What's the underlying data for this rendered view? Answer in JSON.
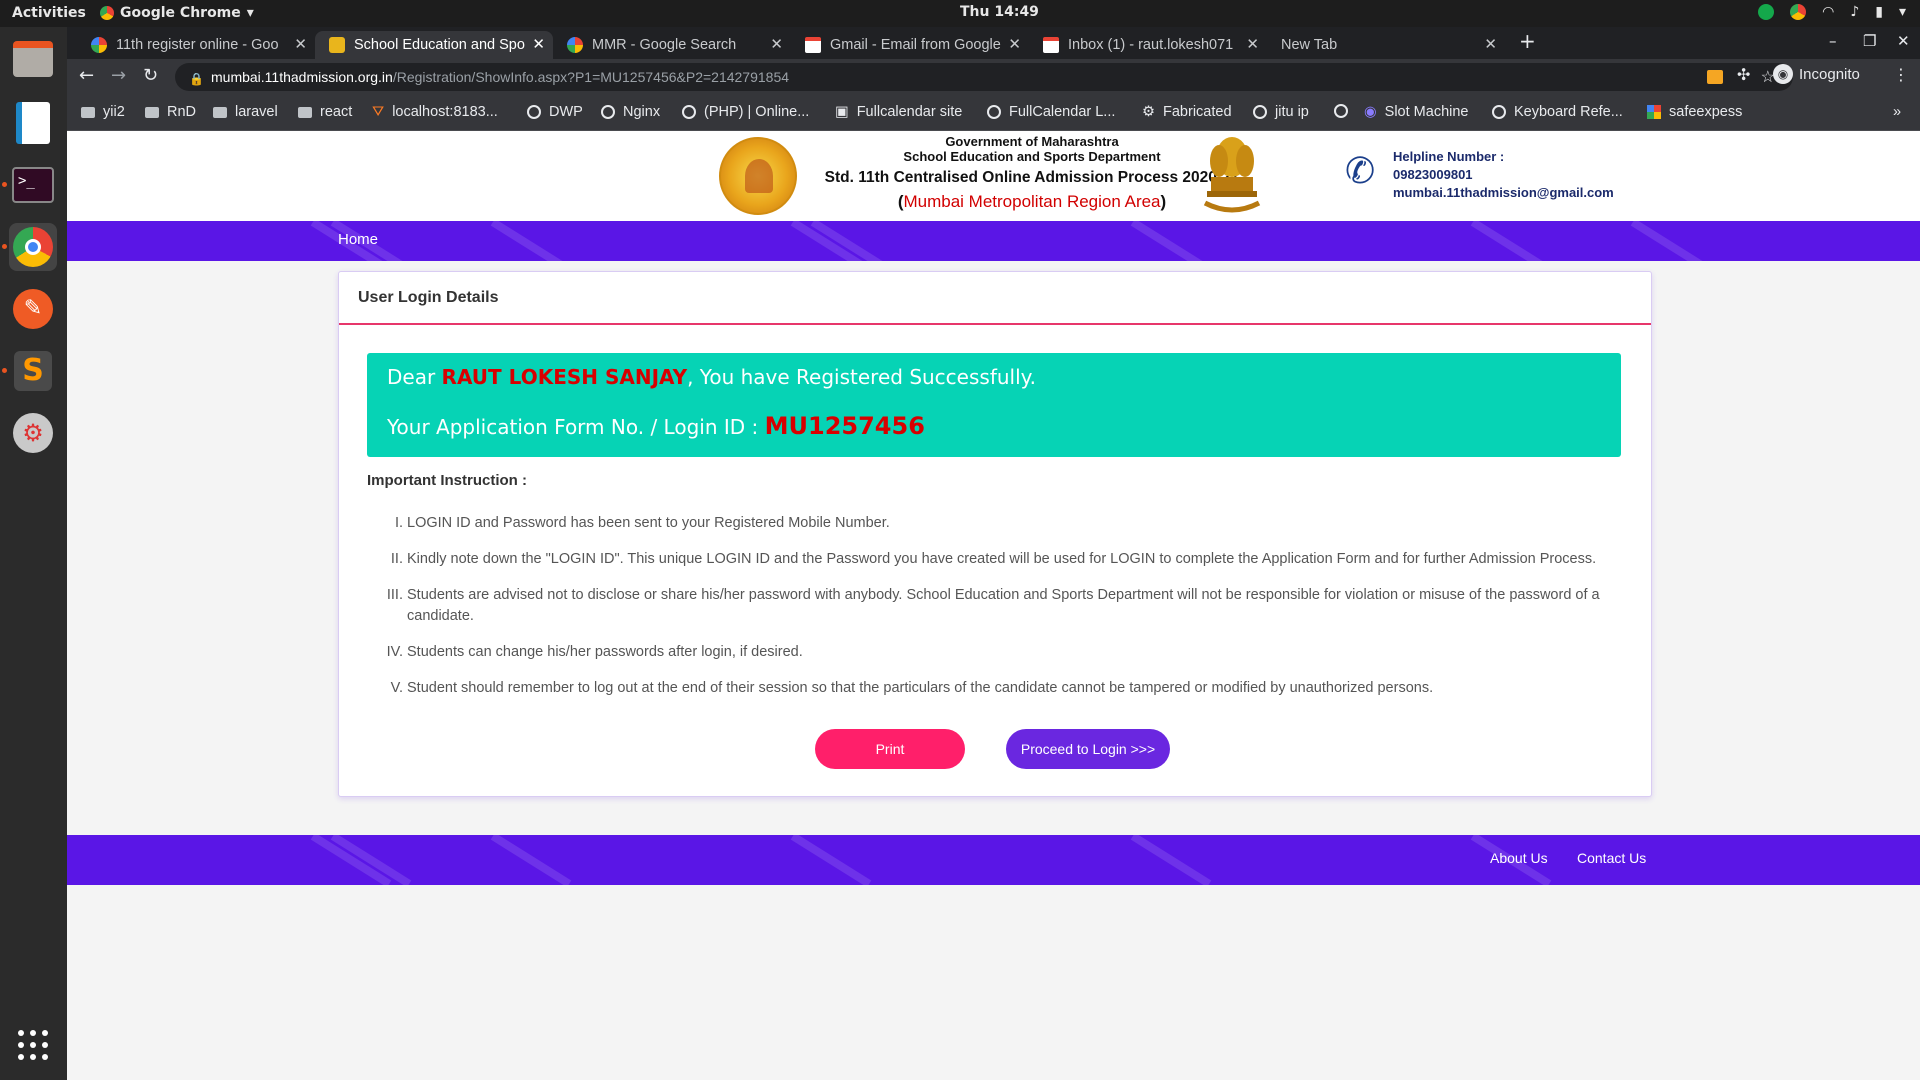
{
  "os": {
    "activities": "Activities",
    "app_name": "Google Chrome",
    "clock": "Thu 14:49"
  },
  "tabs": [
    {
      "title": "11th register online - Goo",
      "active": false
    },
    {
      "title": "School Education and Spo",
      "active": true
    },
    {
      "title": "MMR - Google Search",
      "active": false
    },
    {
      "title": "Gmail - Email from Google",
      "active": false
    },
    {
      "title": "Inbox (1) - raut.lokesh071",
      "active": false
    },
    {
      "title": "New Tab",
      "active": false
    }
  ],
  "address_bar": {
    "host": "mumbai.11thadmission.org.in",
    "path": "/Registration/ShowInfo.aspx?P1=MU1257456&P2=2142791854",
    "incognito_label": "Incognito"
  },
  "bookmarks": [
    {
      "label": "yii2",
      "type": "folder"
    },
    {
      "label": "RnD",
      "type": "folder"
    },
    {
      "label": "laravel",
      "type": "folder"
    },
    {
      "label": "react",
      "type": "folder"
    },
    {
      "label": "localhost:8183...",
      "type": "site"
    },
    {
      "label": "DWP",
      "type": "site"
    },
    {
      "label": "Nginx",
      "type": "site"
    },
    {
      "label": "(PHP) | Online...",
      "type": "site"
    },
    {
      "label": "Fullcalendar site",
      "type": "site"
    },
    {
      "label": "FullCalendar L...",
      "type": "site"
    },
    {
      "label": "Fabricated",
      "type": "site"
    },
    {
      "label": "jitu ip",
      "type": "site"
    },
    {
      "label": "",
      "type": "site"
    },
    {
      "label": "Slot Machine",
      "type": "site"
    },
    {
      "label": "Keyboard Refe...",
      "type": "site"
    },
    {
      "label": "safeexpess",
      "type": "site"
    }
  ],
  "header": {
    "line1": "Government of Maharashtra",
    "line2": "School Education and Sports Department",
    "line3": "Std. 11th Centralised Online Admission Process 2020-21",
    "region_open": "(",
    "region": "Mumbai Metropolitan Region Area",
    "region_close": ")",
    "helpline_label": "Helpline Number :",
    "helpline_phone": "09823009801",
    "helpline_email": "mumbai.11thadmission@gmail.com"
  },
  "nav": {
    "home": "Home"
  },
  "card": {
    "title": "User Login Details",
    "dear": "Dear ",
    "name": "RAUT LOKESH SANJAY",
    "registered": ", You have Registered Successfully.",
    "form_label": "Your Application Form No. / Login ID : ",
    "login_id": "MU1257456",
    "instr_title": "Important Instruction :",
    "instructions": [
      {
        "num": "I.",
        "text": "LOGIN ID and Password has been sent to your Registered Mobile Number."
      },
      {
        "num": "II.",
        "text": "Kindly note down the \"LOGIN ID\". This unique LOGIN ID and the Password you have created will be used for LOGIN to complete the Application Form and for further Admission Process."
      },
      {
        "num": "III.",
        "text": "Students are advised not to disclose or share his/her password with anybody. School Education and Sports Department will not be responsible for violation or misuse of the password of a candidate."
      },
      {
        "num": "IV.",
        "text": "Students can change his/her passwords after login, if desired."
      },
      {
        "num": "V.",
        "text": "Student should remember to log out at the end of their session so that the particulars of the candidate cannot be tampered or modified by unauthorized persons."
      }
    ],
    "print_label": "Print",
    "proceed_label": "Proceed to Login >>>"
  },
  "footer": {
    "about": "About Us",
    "contact": "Contact Us"
  },
  "colors": {
    "brand_purple": "#5a16e6",
    "success_teal": "#06d3b5",
    "accent_red": "#d80000",
    "print_pink": "#ff1f6a"
  }
}
